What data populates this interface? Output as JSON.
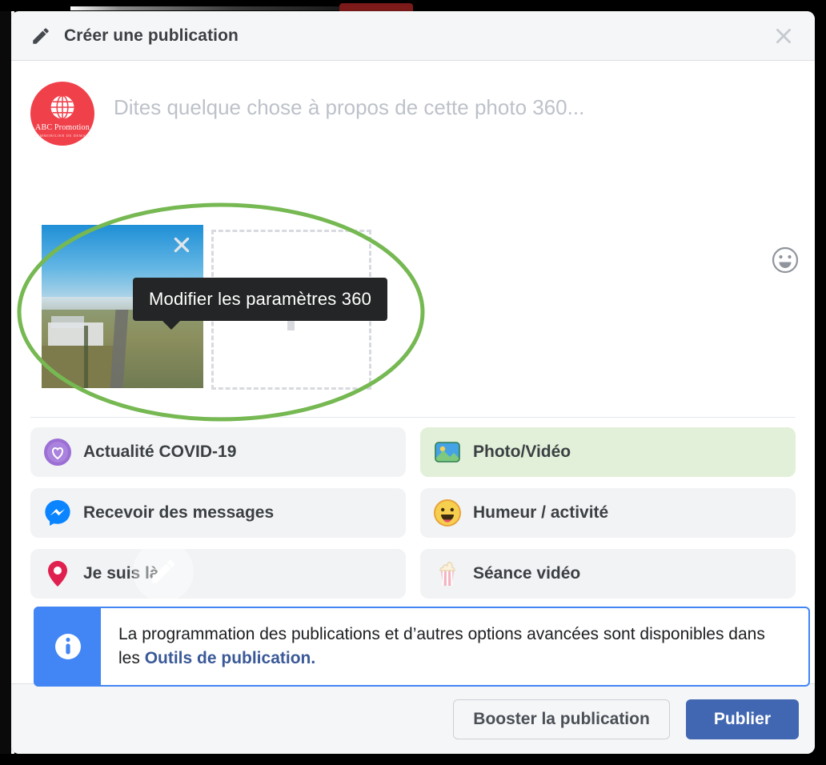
{
  "dialog": {
    "title": "Créer une publication",
    "close_label": "×"
  },
  "composer": {
    "placeholder": "Dites quelque chose à propos de cette photo 360...",
    "avatar": {
      "brand": "ABC Promotion",
      "tagline": "L'IMMOBILIER DE DEMAIN"
    },
    "emoji_icon": "smiley-icon"
  },
  "attachments": {
    "tooltip": "Modifier les paramètres 360",
    "remove_icon": "close-icon",
    "edit_icon": "pencil-icon",
    "dropzone_icon": "add-photo-dropzone"
  },
  "options": {
    "items": [
      {
        "label": "Actualité COVID-19",
        "icon": "covid-heart-icon",
        "selected": false
      },
      {
        "label": "Photo/Vidéo",
        "icon": "photo-video-icon",
        "selected": true
      },
      {
        "label": "Recevoir des messages",
        "icon": "messenger-icon",
        "selected": false
      },
      {
        "label": "Humeur / activité",
        "icon": "feeling-smiley-icon",
        "selected": false
      },
      {
        "label": "Je suis là",
        "icon": "location-pin-icon",
        "selected": false
      },
      {
        "label": "Séance vidéo",
        "icon": "popcorn-icon",
        "selected": false
      }
    ]
  },
  "info_banner": {
    "message": "La programmation des publications et d’autres options avancées sont disponibles dans les ",
    "link_text": "Outils de publication.",
    "icon": "info-icon",
    "accent_color": "#4285f4"
  },
  "footer": {
    "boost_label": "Booster la publication",
    "publish_label": "Publier",
    "publish_color": "#4267b2"
  },
  "annotation": {
    "shape": "ellipse",
    "color": "#76b852"
  }
}
